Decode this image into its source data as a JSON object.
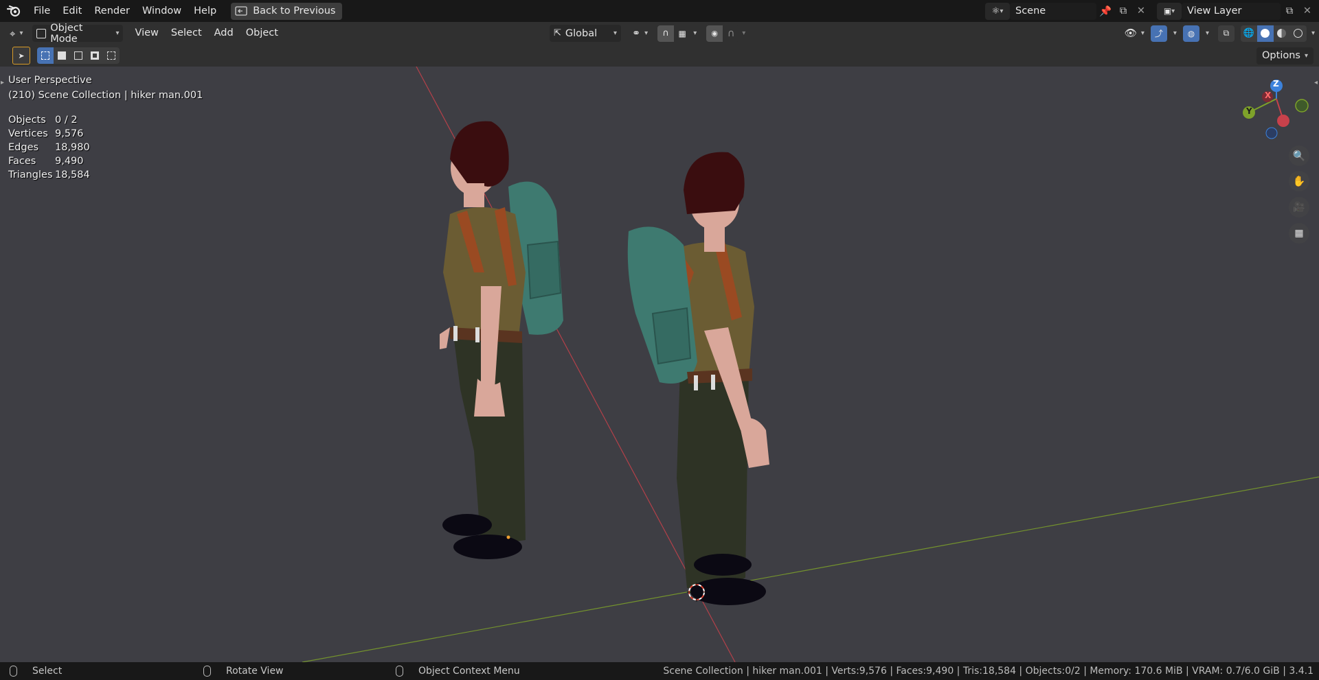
{
  "topbar": {
    "menus": [
      "File",
      "Edit",
      "Render",
      "Window",
      "Help"
    ],
    "back_button": "Back to Previous",
    "scene_name": "Scene",
    "view_layer": "View Layer"
  },
  "header": {
    "mode": "Object Mode",
    "menus": [
      "View",
      "Select",
      "Add",
      "Object"
    ],
    "orientation": "Global"
  },
  "toolheader": {
    "options": "Options"
  },
  "viewport": {
    "perspective": "User Perspective",
    "collection": "(210) Scene Collection | hiker man.001",
    "stats": [
      {
        "label": "Objects",
        "value": "0 / 2"
      },
      {
        "label": "Vertices",
        "value": "9,576"
      },
      {
        "label": "Edges",
        "value": "18,980"
      },
      {
        "label": "Faces",
        "value": "9,490"
      },
      {
        "label": "Triangles",
        "value": "18,584"
      }
    ],
    "gizmo": {
      "z": "Z",
      "x": "X",
      "y": "Y"
    }
  },
  "statusbar": {
    "hint_select": "Select",
    "hint_rotate": "Rotate View",
    "hint_context": "Object Context Menu",
    "info": "Scene Collection | hiker man.001 | Verts:9,576 | Faces:9,490 | Tris:18,584 | Objects:0/2 | Memory: 170.6 MiB | VRAM: 0.7/6.0 GiB | 3.4.1"
  },
  "colors": {
    "x_axis": "#c8414b",
    "y_axis": "#7ea22a",
    "z_axis": "#3c82dc",
    "accent": "#4772b3",
    "viewport_bg": "#3e3e44"
  }
}
